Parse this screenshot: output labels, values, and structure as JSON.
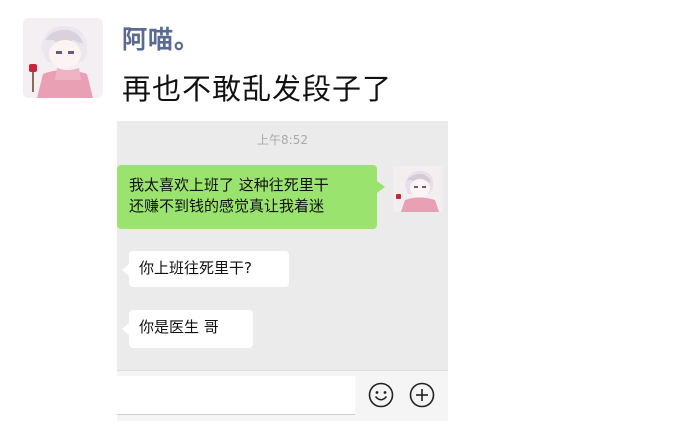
{
  "post": {
    "username": "阿喵。",
    "text": "再也不敢乱发段子了"
  },
  "chat": {
    "timestamp": "上午8:52",
    "messages": [
      {
        "side": "right",
        "text_line1": "我太喜欢上班了 这种往死里干",
        "text_line2": "还赚不到钱的感觉真让我着迷"
      },
      {
        "side": "left",
        "text": "你上班往死里干?"
      },
      {
        "side": "left",
        "text": "你是医生 哥"
      }
    ],
    "input": {
      "value": "",
      "emoji_icon": "emoji-icon",
      "add_icon": "plus-circle-icon"
    }
  },
  "colors": {
    "username": "#5b6a93",
    "sent_bubble": "#9ae36e",
    "chat_background": "#ebebeb"
  }
}
